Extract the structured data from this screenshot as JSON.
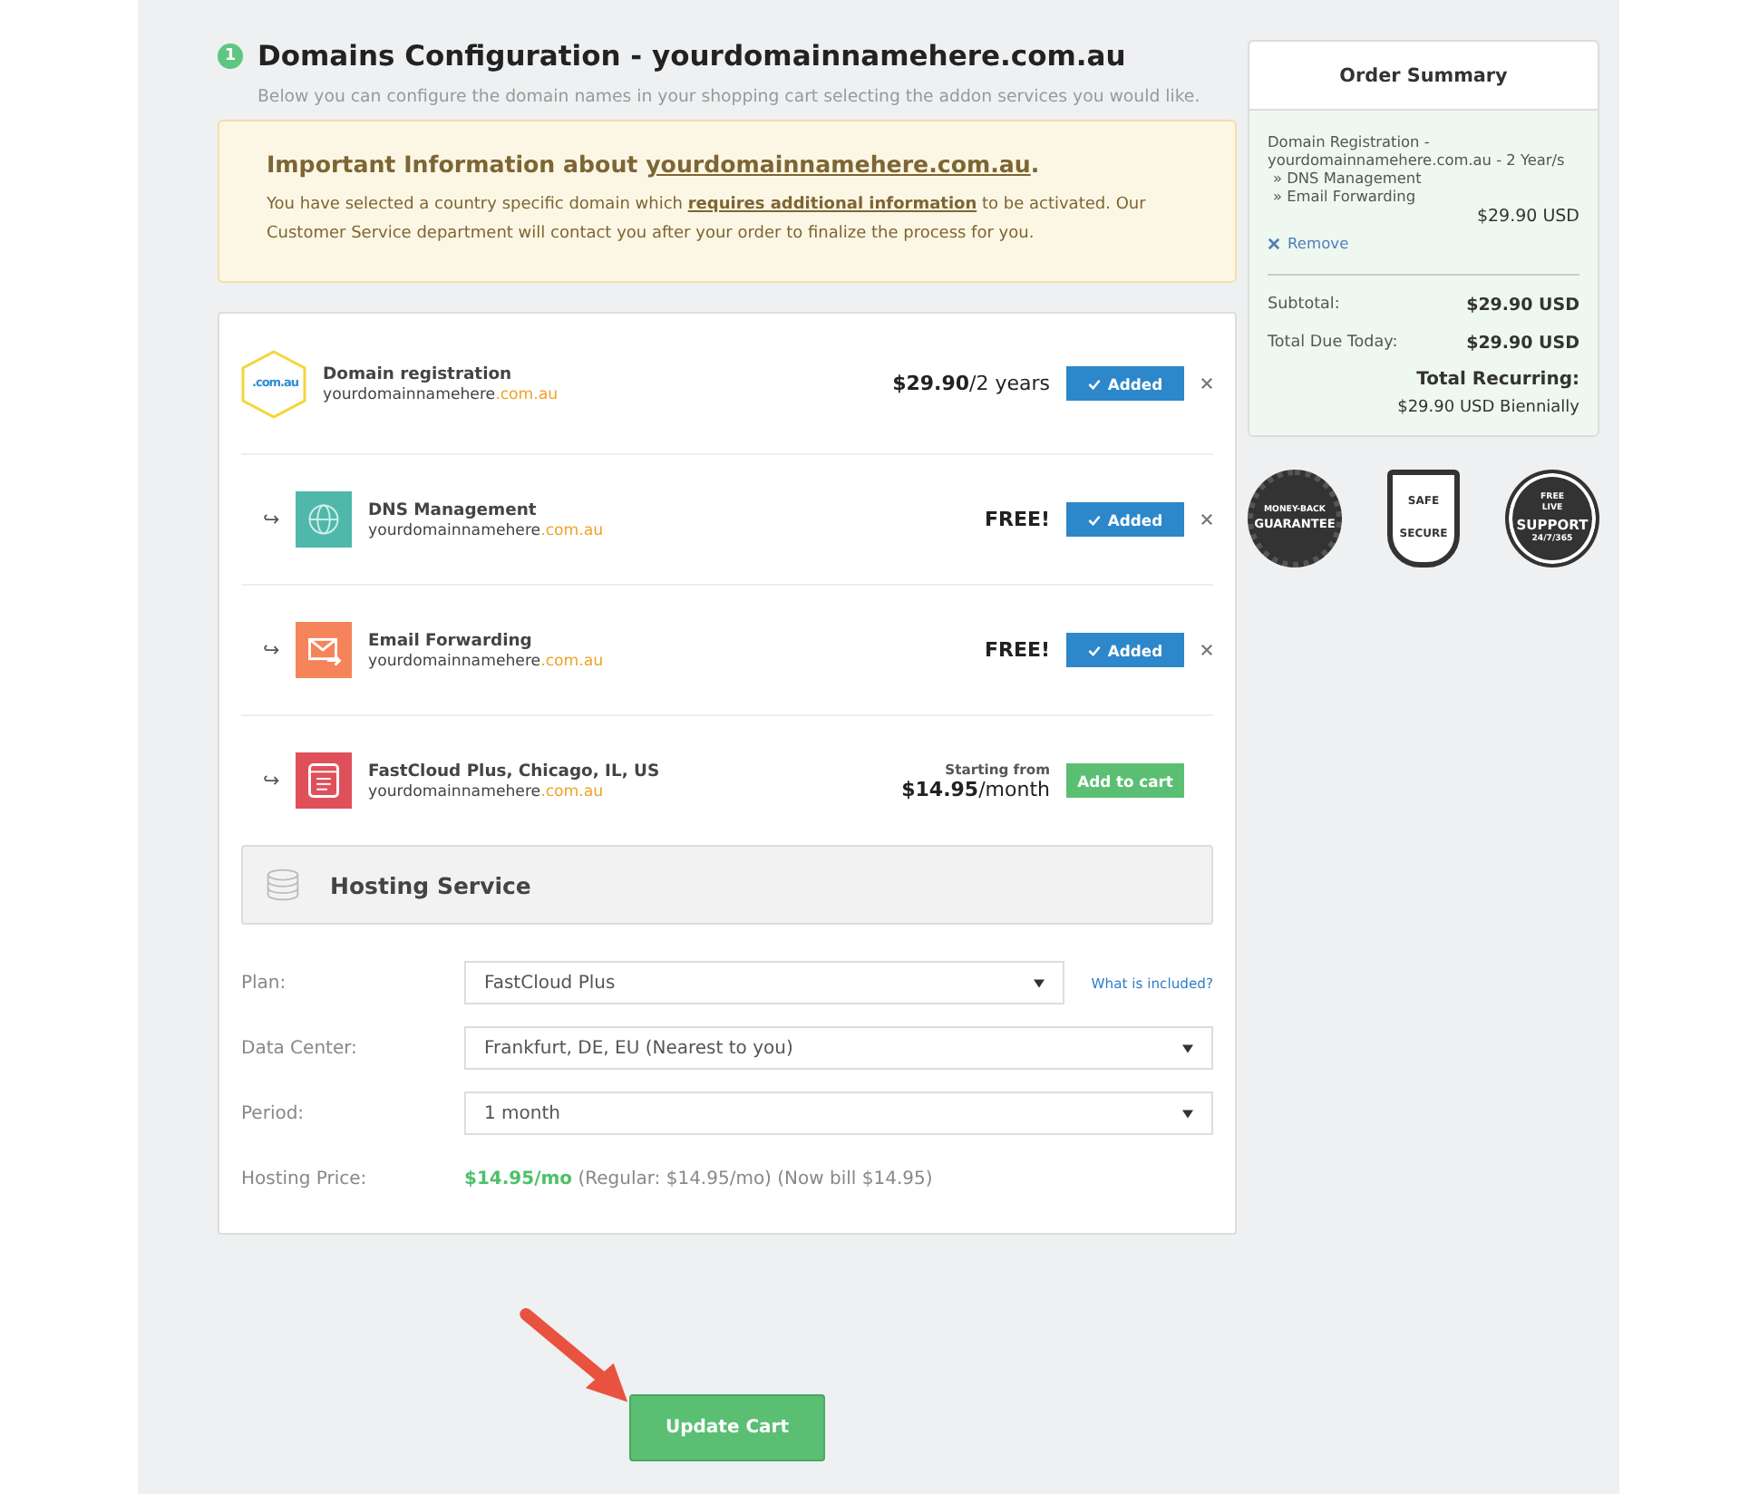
{
  "section": {
    "step": "1",
    "title": "Domains Configuration - yourdomainnamehere.com.au",
    "subtitle": "Below you can configure the domain names in your shopping cart selecting the addon services you would like."
  },
  "notice": {
    "title_prefix": "Important Information about ",
    "title_link": "yourdomainnamehere.com.au",
    "title_suffix": ".",
    "text_before": "You have selected a country specific domain which ",
    "text_link": "requires additional information",
    "text_after": " to be activated. Our Customer Service department will contact you after your order to finalize the process for you."
  },
  "items": [
    {
      "kind": "domain",
      "icon_text": ".com.au",
      "name": "Domain registration",
      "domain_name": "yourdomainnamehere",
      "tld": ".com.au",
      "price": "**$29.90**/2 years",
      "added": true,
      "button": "Added"
    },
    {
      "kind": "dns",
      "name": "DNS Management",
      "domain_name": "yourdomainnamehere",
      "tld": ".com.au",
      "price": "**FREE!**",
      "added": true,
      "button": "Added",
      "arrow": "↪"
    },
    {
      "kind": "email",
      "name": "Email Forwarding",
      "domain_name": "yourdomainnamehere",
      "tld": ".com.au",
      "price": "**FREE!**",
      "added": true,
      "button": "Added",
      "arrow": "↪"
    },
    {
      "kind": "hosting",
      "name": "FastCloud Plus, Chicago, IL, US",
      "domain_name": "yourdomainnamehere",
      "tld": ".com.au",
      "price_note": "Starting from",
      "price": "**$14.95**/month",
      "added": false,
      "button": "Add to cart",
      "arrow": "↪"
    }
  ],
  "hosting": {
    "title": "Hosting Service",
    "fields": [
      {
        "label": "Plan:",
        "value": "FastCloud Plus",
        "link": "What is included?"
      },
      {
        "label": "Data Center:",
        "value": "Frankfurt, DE, EU (Nearest to you)"
      },
      {
        "label": "Period:",
        "value": "1 month"
      }
    ],
    "price_label": "Hosting Price:",
    "price_highlight": "$14.95/mo",
    "price_rest": "(Regular: $14.95/mo) (Now bill $14.95)"
  },
  "update_button": "Update Cart",
  "summary": {
    "title": "Order Summary",
    "lines": [
      "Domain Registration -",
      "yourdomainnamehere.com.au - 2 Year/s",
      "» DNS Management",
      "» Email Forwarding"
    ],
    "item_price": "$29.90 USD",
    "remove": "Remove",
    "totals": [
      {
        "label": "Subtotal:",
        "value": "$29.90 USD"
      },
      {
        "label": "Total Due Today:",
        "value": "$29.90 USD"
      }
    ],
    "recurring_label": "Total Recurring:",
    "recurring_value": "$29.90 USD Biennially"
  },
  "badges": [
    {
      "kind": "guarantee",
      "texts": [
        "MONEY-BACK",
        "GUARANTEE"
      ]
    },
    {
      "kind": "secure",
      "texts": [
        "SAFE",
        "SECURE"
      ]
    },
    {
      "kind": "support",
      "texts": [
        "FREE",
        "LIVE",
        "SUPPORT",
        "24/7/365"
      ]
    }
  ]
}
